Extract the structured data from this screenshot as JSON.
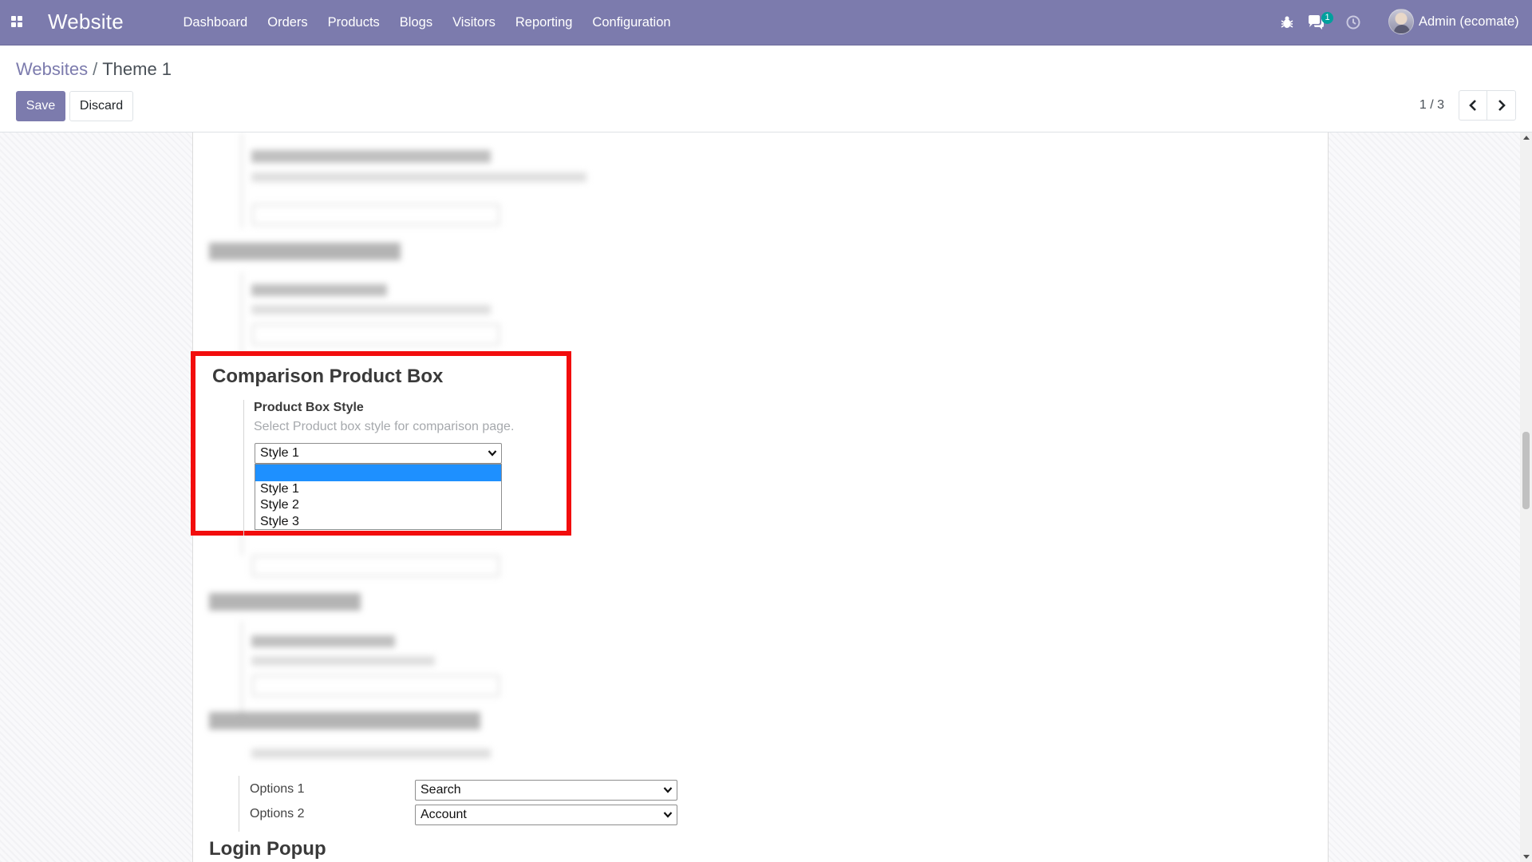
{
  "navbar": {
    "brand": "Website",
    "menu": [
      "Dashboard",
      "Orders",
      "Products",
      "Blogs",
      "Visitors",
      "Reporting",
      "Configuration"
    ],
    "chat_badge": "1",
    "user_name": "Admin (ecomate)",
    "icons": [
      "apps-grid-icon",
      "bug-icon",
      "chat-icon",
      "clock-icon"
    ],
    "colors": {
      "navbar_bg": "#7c7bad",
      "badge_bg": "#00a09d"
    }
  },
  "control_panel": {
    "breadcrumb_parent": "Websites",
    "breadcrumb_separator": "/",
    "breadcrumb_current": "Theme 1",
    "save_label": "Save",
    "discard_label": "Discard",
    "pager_value": "1 / 3"
  },
  "form": {
    "comparison_section": {
      "title": "Comparison Product Box",
      "field_label": "Product Box Style",
      "field_help": "Select Product box style for comparison page.",
      "selected_value": "Style 1",
      "dropdown_options": [
        "",
        "Style 1",
        "Style 2",
        "Style 3"
      ],
      "highlight_color": "#f20d0d",
      "active_option_color": "#1e90ff"
    },
    "options": [
      {
        "label": "Options 1",
        "value": "Search"
      },
      {
        "label": "Options 2",
        "value": "Account"
      }
    ],
    "next_section_title": "Login Popup"
  }
}
